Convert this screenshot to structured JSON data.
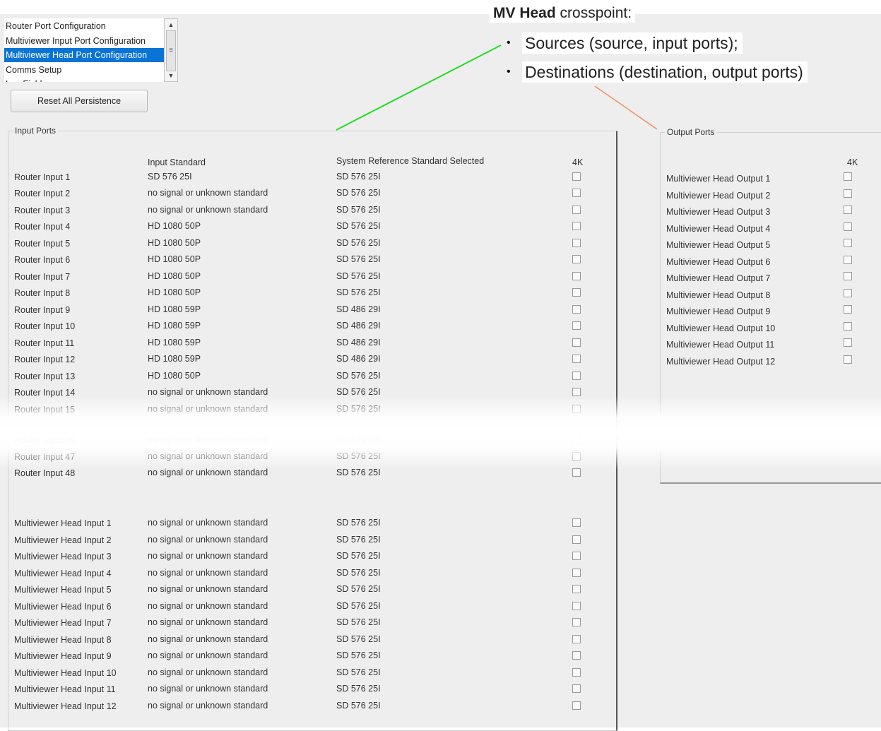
{
  "annotation": {
    "title_bold": "MV Head",
    "title_rest": " crosspoint:",
    "bullets": [
      "Sources (source, input ports);",
      "Destinations (destination, output ports)"
    ],
    "leader_colors": {
      "sources": "#22dd22",
      "destinations": "#f09060"
    }
  },
  "nav": {
    "items": [
      "Router Port Configuration",
      "Multiviewer Input Port Configuration",
      "Multiviewer Head Port Configuration",
      "Comms Setup",
      "Log Fields"
    ],
    "selected_index": 2
  },
  "reset_button": "Reset All Persistence",
  "input_ports": {
    "title": "Input Ports",
    "col_input_standard": "Input Standard",
    "col_system_ref": "System Reference Standard Selected",
    "col_4k": "4K",
    "router_rows": [
      {
        "name": "Router Input 1",
        "standard": "SD 576 25I",
        "ref": "SD 576 25I"
      },
      {
        "name": "Router Input 2",
        "standard": "no signal or unknown standard",
        "ref": "SD 576 25I"
      },
      {
        "name": "Router Input 3",
        "standard": "no signal or unknown standard",
        "ref": "SD 576 25I"
      },
      {
        "name": "Router Input 4",
        "standard": "HD 1080 50P",
        "ref": "SD 576 25I"
      },
      {
        "name": "Router Input 5",
        "standard": "HD 1080 50P",
        "ref": "SD 576 25I"
      },
      {
        "name": "Router Input 6",
        "standard": "HD 1080 50P",
        "ref": "SD 576 25I"
      },
      {
        "name": "Router Input 7",
        "standard": "HD 1080 50P",
        "ref": "SD 576 25I"
      },
      {
        "name": "Router Input 8",
        "standard": "HD 1080 50P",
        "ref": "SD 576 25I"
      },
      {
        "name": "Router Input 9",
        "standard": "HD 1080 59P",
        "ref": "SD 486 29I"
      },
      {
        "name": "Router Input 10",
        "standard": "HD 1080 59P",
        "ref": "SD 486 29I"
      },
      {
        "name": "Router Input 11",
        "standard": "HD 1080 59P",
        "ref": "SD 486 29I"
      },
      {
        "name": "Router Input 12",
        "standard": "HD 1080 59P",
        "ref": "SD 486 29I"
      },
      {
        "name": "Router Input 13",
        "standard": "HD 1080 50P",
        "ref": "SD 576 25I"
      },
      {
        "name": "Router Input 14",
        "standard": "no signal or unknown standard",
        "ref": "SD 576 25I"
      },
      {
        "name": "Router Input 15",
        "standard": "no signal or unknown standard",
        "ref": "SD 576 25I"
      },
      {
        "name": "Router Input 46",
        "standard": "no signal or unknown standard",
        "ref": "SD 576 25I"
      },
      {
        "name": "Router Input 47",
        "standard": "no signal or unknown standard",
        "ref": "SD 576 25I"
      },
      {
        "name": "Router Input 48",
        "standard": "no signal or unknown standard",
        "ref": "SD 576 25I"
      }
    ],
    "mv_rows": [
      {
        "name": "Multiviewer Head Input 1",
        "standard": "no signal or unknown standard",
        "ref": "SD 576 25I"
      },
      {
        "name": "Multiviewer Head Input 2",
        "standard": "no signal or unknown standard",
        "ref": "SD 576 25I"
      },
      {
        "name": "Multiviewer Head Input 3",
        "standard": "no signal or unknown standard",
        "ref": "SD 576 25I"
      },
      {
        "name": "Multiviewer Head Input 4",
        "standard": "no signal or unknown standard",
        "ref": "SD 576 25I"
      },
      {
        "name": "Multiviewer Head Input 5",
        "standard": "no signal or unknown standard",
        "ref": "SD 576 25I"
      },
      {
        "name": "Multiviewer Head Input 6",
        "standard": "no signal or unknown standard",
        "ref": "SD 576 25I"
      },
      {
        "name": "Multiviewer Head Input 7",
        "standard": "no signal or unknown standard",
        "ref": "SD 576 25I"
      },
      {
        "name": "Multiviewer Head Input 8",
        "standard": "no signal or unknown standard",
        "ref": "SD 576 25I"
      },
      {
        "name": "Multiviewer Head Input 9",
        "standard": "no signal or unknown standard",
        "ref": "SD 576 25I"
      },
      {
        "name": "Multiviewer Head Input 10",
        "standard": "no signal or unknown standard",
        "ref": "SD 576 25I"
      },
      {
        "name": "Multiviewer Head Input 11",
        "standard": "no signal or unknown standard",
        "ref": "SD 576 25I"
      },
      {
        "name": "Multiviewer Head Input 12",
        "standard": "no signal or unknown standard",
        "ref": "SD 576 25I"
      }
    ]
  },
  "output_ports": {
    "title": "Output Ports",
    "col_4k": "4K",
    "rows": [
      "Multiviewer Head Output 1",
      "Multiviewer Head Output 2",
      "Multiviewer Head Output 3",
      "Multiviewer Head Output 4",
      "Multiviewer Head Output 5",
      "Multiviewer Head Output 6",
      "Multiviewer Head Output 7",
      "Multiviewer Head Output 8",
      "Multiviewer Head Output 9",
      "Multiviewer Head Output 10",
      "Multiviewer Head Output 11",
      "Multiviewer Head Output 12"
    ]
  }
}
